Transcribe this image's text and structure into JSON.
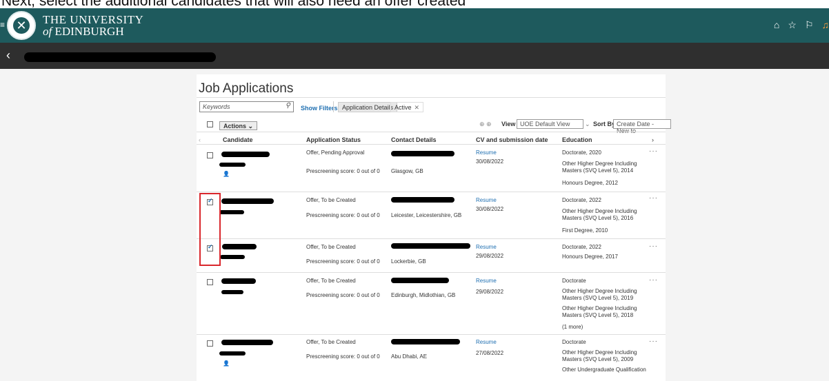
{
  "caption": "Next, select the additional candidates that will also need an offer created",
  "header": {
    "university_line1": "THE UNIVERSITY",
    "university_line2_prefix": "of",
    "university_line2": "EDINBURGH",
    "icons": [
      "home-icon",
      "star-icon",
      "flag-icon",
      "bell-icon"
    ]
  },
  "panel": {
    "title": "Job Applications",
    "keywords_placeholder": "Keywords",
    "show_filters": "Show Filters",
    "chip_application_details": "Application Details",
    "chip_active": "Active",
    "actions": "Actions",
    "view_label": "View",
    "view_value": "UOE Default View",
    "sort_label": "Sort By",
    "sort_value": "Create Date - New to"
  },
  "columns": [
    "Candidate",
    "Application Status",
    "Contact Details",
    "CV and submission date",
    "Education"
  ],
  "rows": [
    {
      "status": "Offer, Pending Approval",
      "score": "Prescreening score: 0 out of 0",
      "location": "Glasgow, GB",
      "resume": "Resume",
      "date": "30/08/2022",
      "checked": false,
      "education": [
        "Doctorate, 2020",
        "Other Higher Degree Including Masters (SVQ Level 5), 2014",
        "Honours Degree, 2012"
      ]
    },
    {
      "status": "Offer, To be Created",
      "score": "Prescreening score: 0 out of 0",
      "location": "Leicester, Leicestershire, GB",
      "resume": "Resume",
      "date": "30/08/2022",
      "checked": true,
      "education": [
        "Doctorate, 2022",
        "Other Higher Degree Including Masters (SVQ Level 5), 2016",
        "First Degree, 2010"
      ]
    },
    {
      "status": "Offer, To be Created",
      "score": "Prescreening score: 0 out of 0",
      "location": "Lockerbie, GB",
      "resume": "Resume",
      "date": "29/08/2022",
      "checked": true,
      "education": [
        "Doctorate, 2022",
        "Honours Degree, 2017"
      ]
    },
    {
      "status": "Offer, To be Created",
      "score": "Prescreening score: 0 out of 0",
      "location": "Edinburgh, Midlothian, GB",
      "resume": "Resume",
      "date": "29/08/2022",
      "checked": false,
      "education": [
        "Doctorate",
        "Other Higher Degree Including Masters (SVQ Level 5), 2019",
        "Other Higher Degree Including Masters (SVQ Level 5), 2018",
        "(1 more)"
      ]
    },
    {
      "status": "Offer, To be Created",
      "score": "Prescreening score: 0 out of 0",
      "location": "Abu Dhabi, AE",
      "resume": "Resume",
      "date": "27/08/2022",
      "checked": false,
      "education": [
        "Doctorate",
        "Other Higher Degree Including Masters (SVQ Level 5), 2009",
        "Other Undergraduate Qualification"
      ]
    }
  ]
}
